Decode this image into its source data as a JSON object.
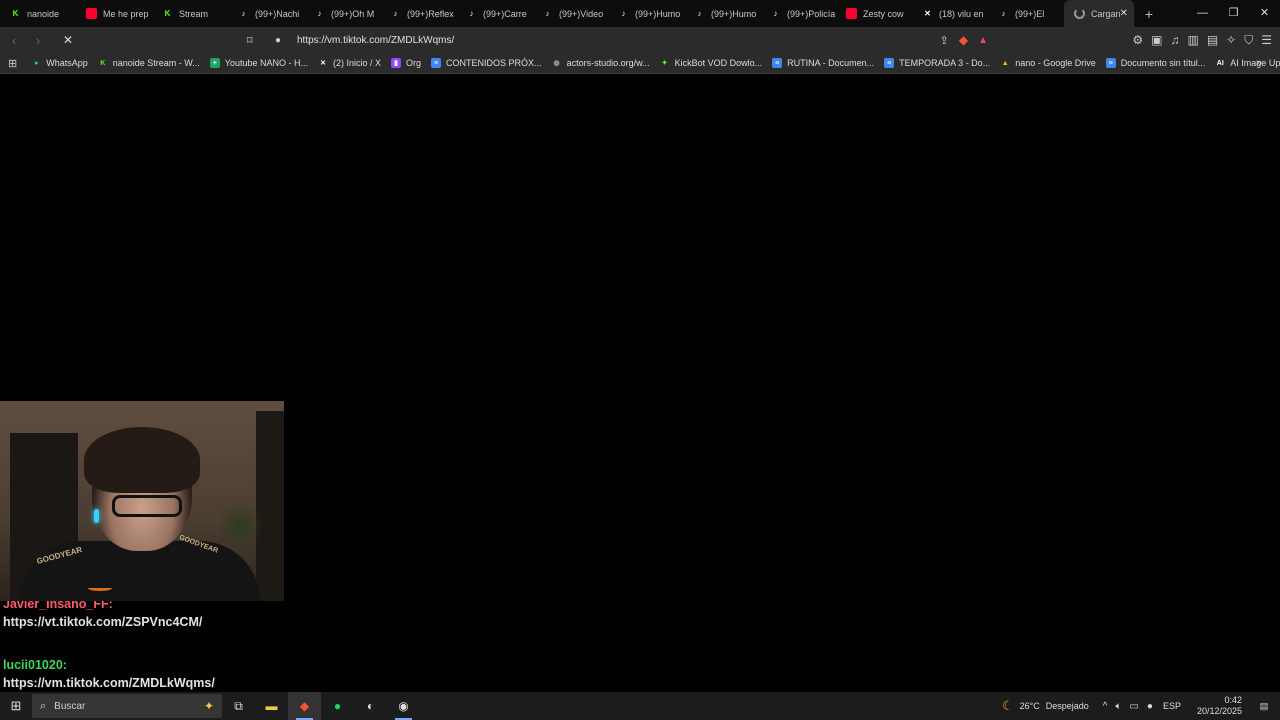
{
  "browser": {
    "tabs": [
      {
        "label": "nanoide",
        "icon": "kick-icon",
        "color": "#53fc18"
      },
      {
        "label": "Me he prep",
        "icon": "youtube-icon",
        "color": "#ff0033"
      },
      {
        "label": "Stream",
        "icon": "kick-icon",
        "color": "#53fc18"
      },
      {
        "label": "(99+)Nachi",
        "icon": "tiktok-icon",
        "color": "#ffffff"
      },
      {
        "label": "(99+)Oh M",
        "icon": "tiktok-icon",
        "color": "#ffffff"
      },
      {
        "label": "(99+)Reflex",
        "icon": "tiktok-icon",
        "color": "#ffffff"
      },
      {
        "label": "(99+)Carre",
        "icon": "tiktok-icon",
        "color": "#ffffff"
      },
      {
        "label": "(99+)Video",
        "icon": "tiktok-icon",
        "color": "#ffffff"
      },
      {
        "label": "(99+)Humo",
        "icon": "tiktok-icon",
        "color": "#ffffff"
      },
      {
        "label": "(99+)Humo",
        "icon": "tiktok-icon",
        "color": "#ffffff"
      },
      {
        "label": "(99+)Policía",
        "icon": "tiktok-icon",
        "color": "#ffffff"
      },
      {
        "label": "Zesty cow",
        "icon": "youtube-icon",
        "color": "#ff0033"
      },
      {
        "label": "(18) vilu en",
        "icon": "x-icon",
        "color": "#ffffff"
      },
      {
        "label": "(99+)El",
        "icon": "tiktok-icon",
        "color": "#ffffff"
      }
    ],
    "active_tab": {
      "label": "Cargan",
      "icon": "loading-spinner-icon"
    },
    "url": "https://vm.tiktok.com/ZMDLkWqms/",
    "bookmarks": [
      {
        "label": "WhatsApp",
        "icon": "whatsapp-icon",
        "color": "#25d366"
      },
      {
        "label": "nanoide Stream - W...",
        "icon": "kick-icon",
        "color": "#53fc18"
      },
      {
        "label": "Youtube NANO - H...",
        "icon": "sheets-icon",
        "color": "#1fa463"
      },
      {
        "label": "(2) Inicio / X",
        "icon": "x-icon",
        "color": "#ffffff"
      },
      {
        "label": "Org",
        "icon": "twitch-icon",
        "color": "#9146ff"
      },
      {
        "label": "CONTENIDOS PRÓX...",
        "icon": "docs-icon",
        "color": "#4285f4"
      },
      {
        "label": "actors-studio.org/w...",
        "icon": "globe-icon",
        "color": "#aaaaaa"
      },
      {
        "label": "KickBot VOD Dowlo...",
        "icon": "kickbot-icon",
        "color": "#53fc18"
      },
      {
        "label": "RUTINA - Documen...",
        "icon": "docs-icon",
        "color": "#4285f4"
      },
      {
        "label": "TEMPORADA 3 - Do...",
        "icon": "docs-icon",
        "color": "#4285f4"
      },
      {
        "label": "nano - Google Drive",
        "icon": "drive-icon",
        "color": "#fbbc04"
      },
      {
        "label": "Documento sin títul...",
        "icon": "docs-icon",
        "color": "#4285f4"
      },
      {
        "label": "AI Image Upscaler |...",
        "icon": "ai-icon",
        "color": "#ffffff"
      }
    ]
  },
  "webcam": {
    "logo_left": "GOODYEAR",
    "logo_right": "GOODYEAR"
  },
  "chat": [
    {
      "user": "Javier_Insano_FF:",
      "user_color": "#ff5b6e",
      "message": "https://vt.tiktok.com/ZSPVnc4CM/"
    },
    {
      "user": "lucii01020:",
      "user_color": "#3cd65b",
      "message": "https://vm.tiktok.com/ZMDLkWqms/"
    }
  ],
  "taskbar": {
    "search_placeholder": "Buscar",
    "weather_temp": "26°C",
    "weather_desc": "Despejado",
    "language": "ESP",
    "time": "0:42",
    "date": "20/12/2025"
  }
}
